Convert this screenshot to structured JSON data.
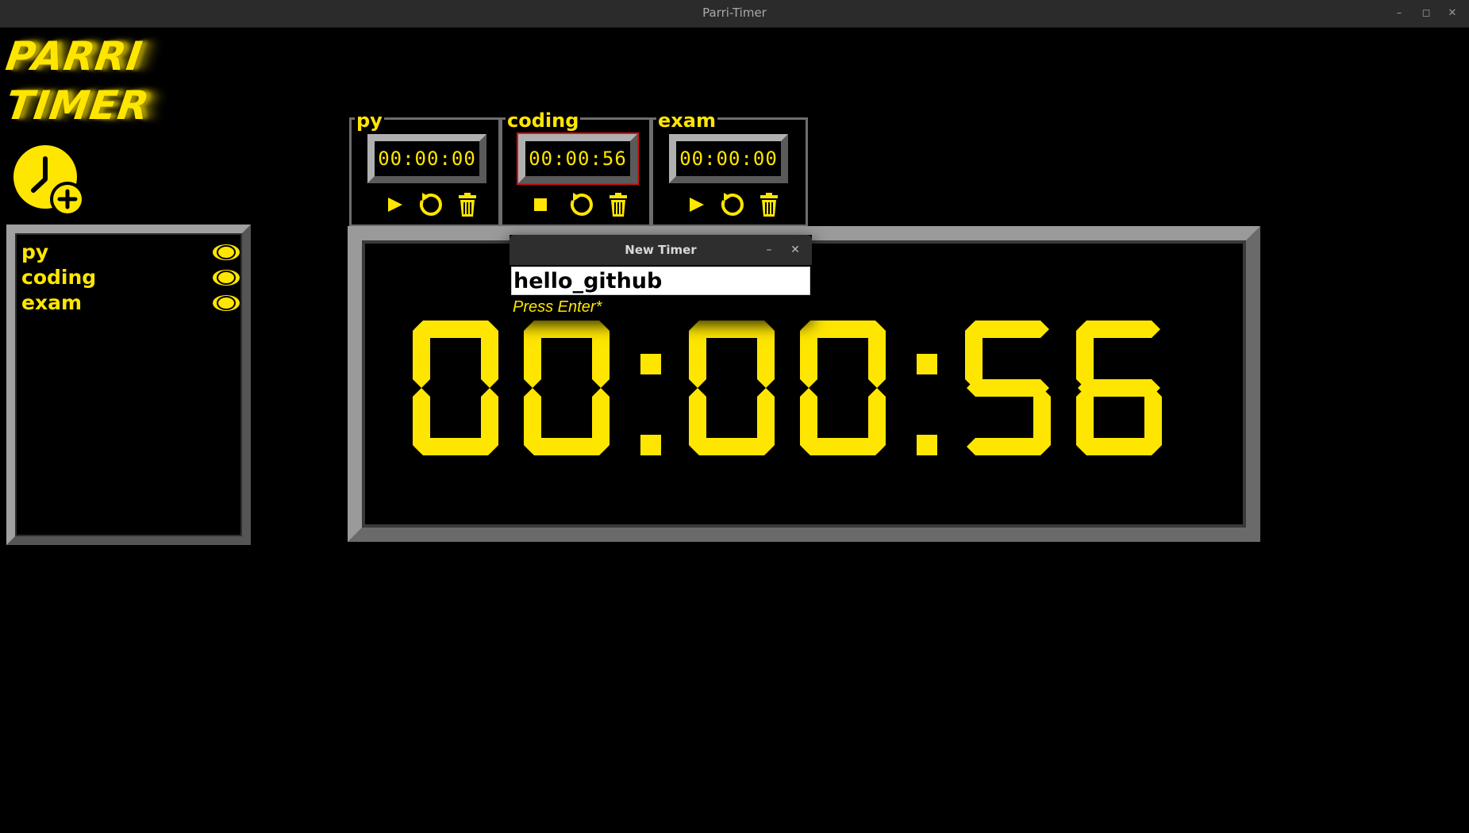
{
  "window": {
    "title": "Parri-Timer"
  },
  "logo": {
    "line1": "PARRI",
    "line2": "TIMER"
  },
  "accent": "#ffe600",
  "sidebar": {
    "add_timer_icon": "clock-plus-icon",
    "items": [
      {
        "label": "py"
      },
      {
        "label": "coding"
      },
      {
        "label": "exam"
      }
    ]
  },
  "timers": [
    {
      "label": "py",
      "time": "00:00:00",
      "state": "stopped",
      "active": false
    },
    {
      "label": "coding",
      "time": "00:00:56",
      "state": "running",
      "active": true
    },
    {
      "label": "exam",
      "time": "00:00:00",
      "state": "stopped",
      "active": false
    }
  ],
  "main_display": {
    "time": "00:00:56"
  },
  "dialog": {
    "title": "New Timer",
    "input_value": "hello_github",
    "hint": "Press Enter*"
  }
}
